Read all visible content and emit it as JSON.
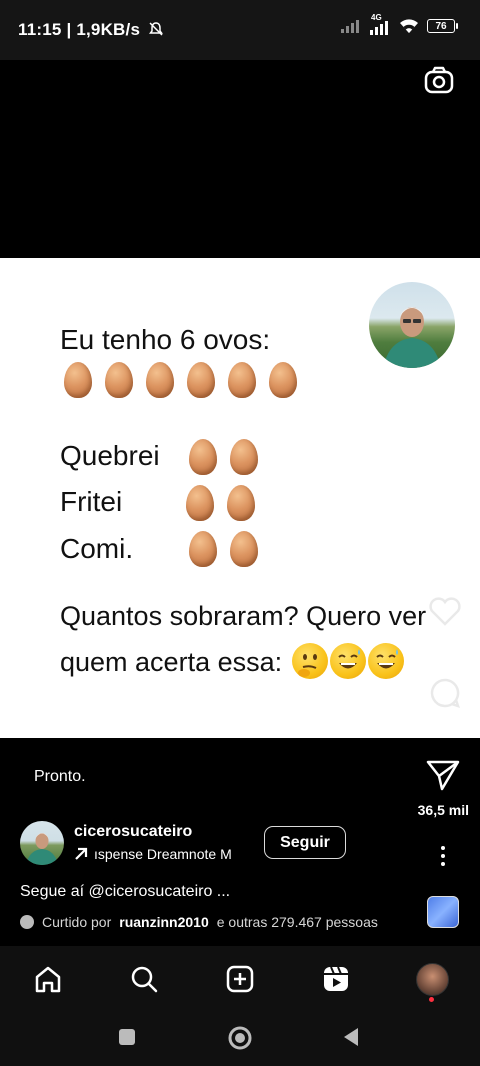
{
  "status_bar": {
    "time_speed": "11:15 | 1,9KB/s",
    "network": "4G",
    "battery": "76",
    "icons": [
      "bell-off-icon",
      "signal-icon",
      "wifi-icon",
      "battery-icon"
    ]
  },
  "top": {
    "camera_icon": "camera-icon"
  },
  "post": {
    "line1": "Eu tenho 6 ovos:",
    "label_quebrei": "Quebrei",
    "label_fritei": "Fritei",
    "label_comi": "Comi.",
    "question_line1": "Quantos sobraram? Quero ver",
    "question_line2": "quem acerta essa:",
    "emojis": [
      "thinking-emoji",
      "laughing-sweat-emoji",
      "laughing-sweat-emoji"
    ],
    "egg_counts": {
      "total": 6,
      "quebrei": 2,
      "fritei": 2,
      "comi": 2
    }
  },
  "reel": {
    "pronto": "Pronto.",
    "shares": "36,5 mil",
    "username": "cicerosucateiro",
    "audio_text": "ıspense   Dreamnote M",
    "follow_label": "Seguir",
    "caption": "Segue aí @cicerosucateiro ...",
    "liked_prefix": "Curtido por",
    "liked_user": "ruanzinn2010",
    "liked_suffix": "e outras 279.467 pessoas"
  },
  "nav": {
    "items": [
      "home-icon",
      "search-icon",
      "create-icon",
      "reels-icon",
      "profile-avatar"
    ]
  },
  "system_nav": [
    "recents-icon",
    "home-circle-icon",
    "back-icon"
  ],
  "colors": {
    "background": "#000000",
    "post_bg": "#ffffff",
    "accent_red": "#ff3040"
  }
}
